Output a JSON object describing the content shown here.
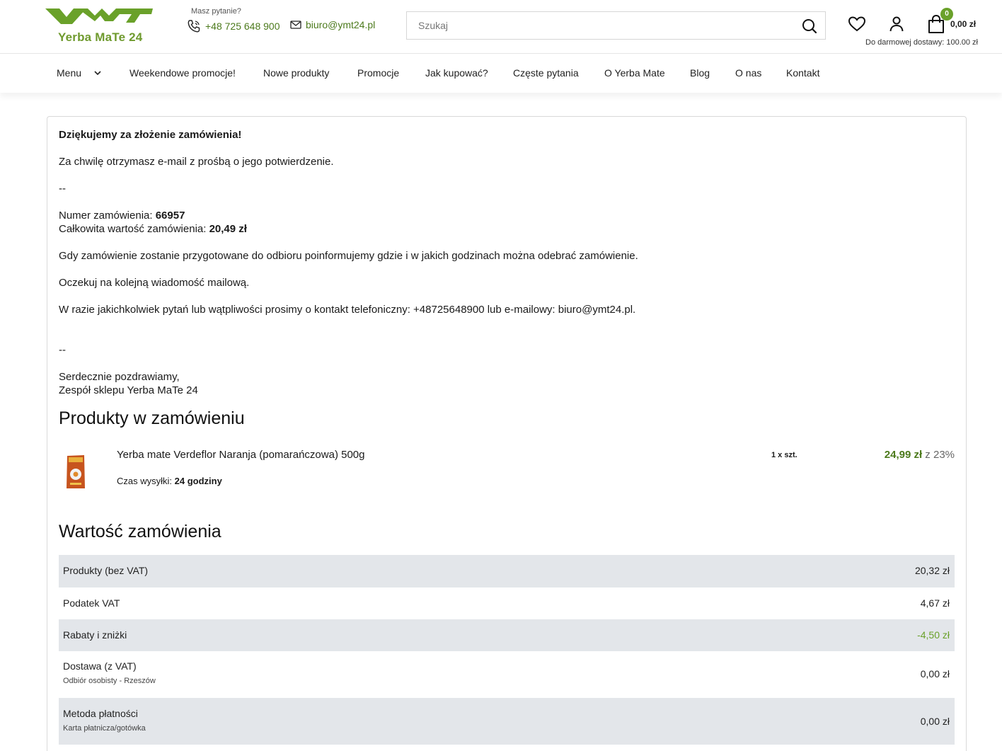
{
  "brand": {
    "logo_text": "Yerba MaTe 24",
    "accent_color": "#6aa12a"
  },
  "header": {
    "question": "Masz pytanie?",
    "phone": "+48 725 648 900",
    "email": "biuro@ymt24.pl",
    "search_placeholder": "Szukaj",
    "cart_count": "0",
    "cart_total": "0,00 zł",
    "free_delivery": "Do darmowej dostawy: 100.00 zł"
  },
  "nav": {
    "items": [
      {
        "label": "Menu"
      },
      {
        "label": "Weekendowe promocje!"
      },
      {
        "label": "Nowe produkty"
      },
      {
        "label": "Promocje"
      },
      {
        "label": "Jak kupować?"
      },
      {
        "label": "Częste pytania"
      },
      {
        "label": "O Yerba Mate"
      },
      {
        "label": "Blog"
      },
      {
        "label": "O nas"
      },
      {
        "label": "Kontakt"
      }
    ]
  },
  "confirmation": {
    "thanks": "Dziękujemy za złożenie zamówienia!",
    "email_info": "Za chwilę otrzymasz e-mail z prośbą o jego potwierdzenie.",
    "separator": "--",
    "order_number_label": "Numer zamówienia: ",
    "order_number": "66957",
    "order_total_label": "Całkowita wartość zamówienia: ",
    "order_total": "20,49 zł",
    "pickup_info": "Gdy zamówienie zostanie przygotowane do odbioru poinformujemy gdzie i w jakich godzinach można odebrać zamówienie.",
    "wait_info": "Oczekuj na kolejną wiadomość mailową.",
    "contact_info": "W razie jakichkolwiek pytań lub wątpliwości prosimy o kontakt telefoniczny: +48725648900 lub e-mailowy: biuro@ymt24.pl.",
    "greeting": "Serdecznie pozdrawiamy,",
    "signature": "Zespół sklepu Yerba MaTe 24"
  },
  "products": {
    "heading": "Produkty w zamówieniu",
    "items": [
      {
        "name": "Yerba mate Verdeflor Naranja (pomarańczowa) 500g",
        "ship_label": "Czas wysyłki: ",
        "ship_time": "24 godziny",
        "qty": "1 x szt.",
        "price": "24,99 zł",
        "vat": " z 23%"
      }
    ]
  },
  "summary": {
    "heading": "Wartość zamówienia",
    "rows": [
      {
        "label": "Produkty (bez VAT)",
        "value": "20,32 zł"
      },
      {
        "label": "Podatek VAT",
        "value": "4,67 zł"
      },
      {
        "label": "Rabaty i zniżki",
        "value": "-4,50 zł"
      },
      {
        "label": "Dostawa (z VAT)",
        "sub": "Odbiór osobisty - Rzeszów",
        "value": "0,00 zł"
      },
      {
        "label": "Metoda płatności",
        "sub": "Karta płatnicza/gotówka",
        "value": "0,00 zł"
      }
    ]
  }
}
